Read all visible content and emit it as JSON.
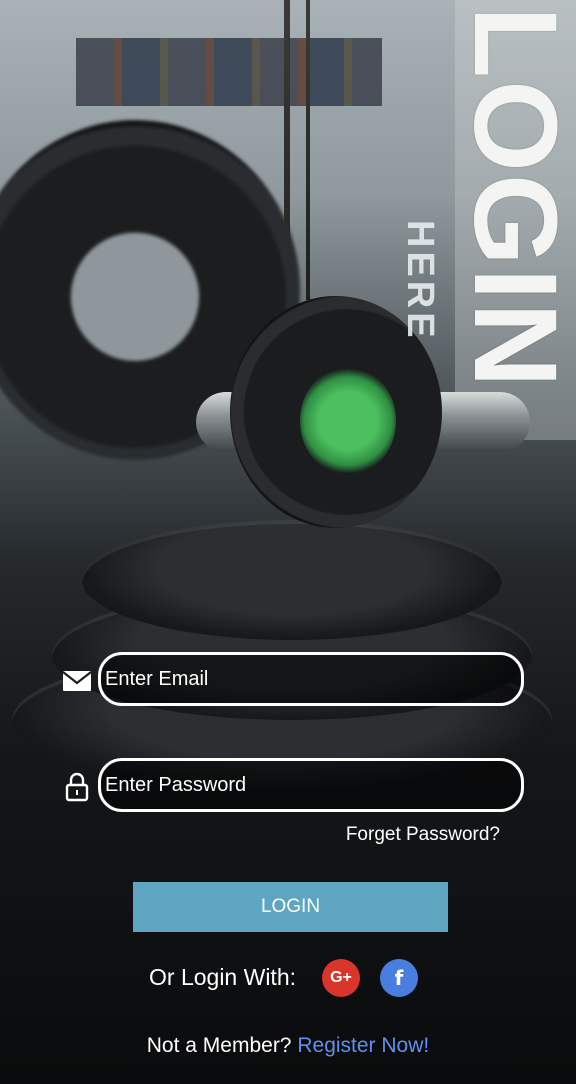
{
  "background": {
    "headline": "LOGIN",
    "subline": "HERE"
  },
  "form": {
    "email_placeholder": "Enter Email",
    "password_placeholder": "Enter Password",
    "email_icon": "mail-icon",
    "password_icon": "lock-icon"
  },
  "links": {
    "forget_password": "Forget Password?"
  },
  "buttons": {
    "login": "LOGIN"
  },
  "social": {
    "label": "Or Login With:",
    "google_label": "G+",
    "facebook_label": "f"
  },
  "footer": {
    "not_member": "Not a Member?",
    "register": "Register Now!"
  },
  "colors": {
    "login_button": "#5ea5c2",
    "google": "#d9352b",
    "facebook": "#4a7de0",
    "register_link": "#5e90ef"
  }
}
